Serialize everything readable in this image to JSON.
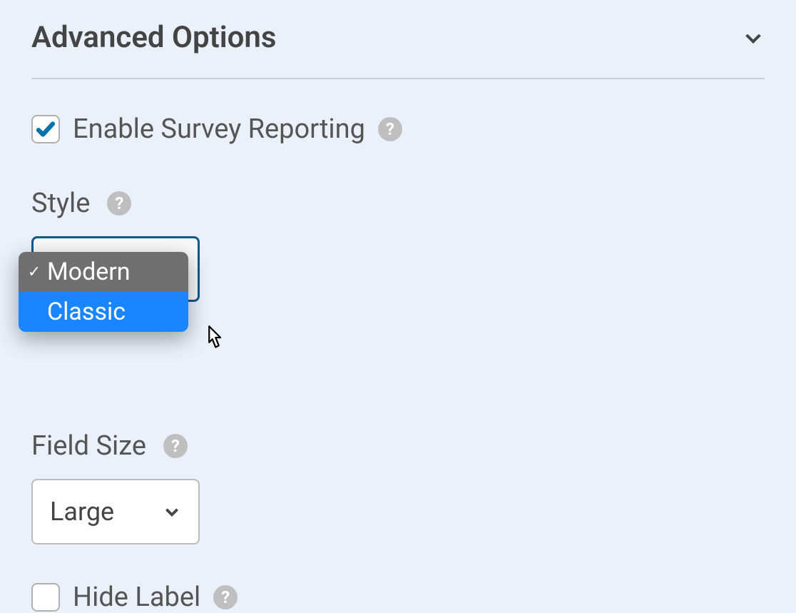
{
  "section": {
    "title": "Advanced Options"
  },
  "enable_survey": {
    "label": "Enable Survey Reporting",
    "checked": true,
    "help": "?"
  },
  "style": {
    "label": "Style",
    "help": "?",
    "options": [
      {
        "label": "Modern",
        "selected": true
      },
      {
        "label": "Classic",
        "selected": false,
        "highlighted": true
      }
    ]
  },
  "field_size": {
    "label": "Field Size",
    "help": "?",
    "value": "Large"
  },
  "hide_label": {
    "label": "Hide Label",
    "checked": false,
    "help": "?"
  }
}
